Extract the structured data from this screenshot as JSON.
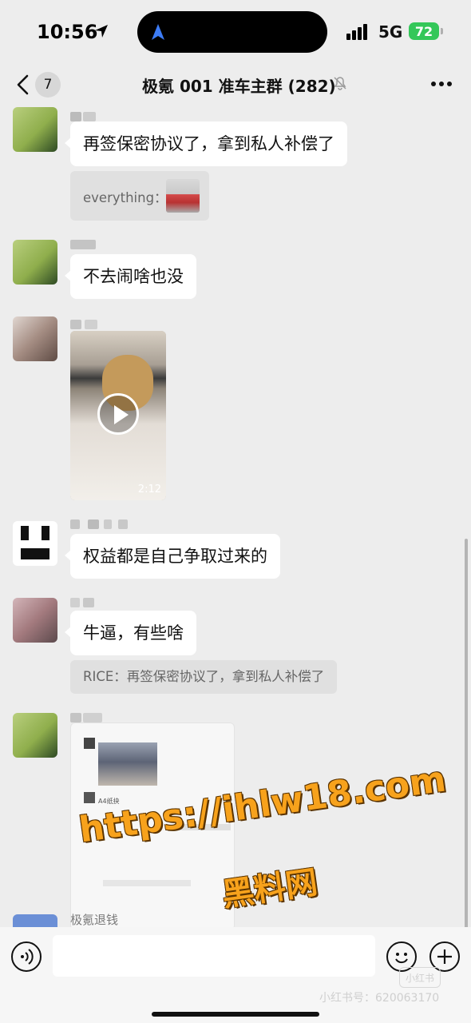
{
  "status_bar": {
    "time": "10:56",
    "network": "5G",
    "battery": "72"
  },
  "header": {
    "unread_count": "7",
    "title": "极氪 001 准车主群 (282)"
  },
  "messages": [
    {
      "text": "再签保密协议了，拿到私人补偿了",
      "quote": "everything："
    },
    {
      "text": "不去闹啥也没"
    },
    {
      "video_duration": "2:12"
    },
    {
      "text": "权益都是自己争取过来的"
    },
    {
      "text": "牛逼，有些啥",
      "quote": "RICE：再签保密协议了，拿到私人补偿了"
    },
    {
      "sender": "极氪退钱"
    }
  ],
  "screenshot_preview": {
    "caption": "A4纸抉"
  },
  "watermark": {
    "url": "https://ihlw18.com",
    "site_name": "黑料网"
  },
  "footer": {
    "logo": "小红书",
    "user_id": "小红书号：620063170"
  },
  "colors": {
    "accent_battery": "#34c759",
    "watermark": "#f7a21c",
    "chat_bg": "#ededed"
  }
}
